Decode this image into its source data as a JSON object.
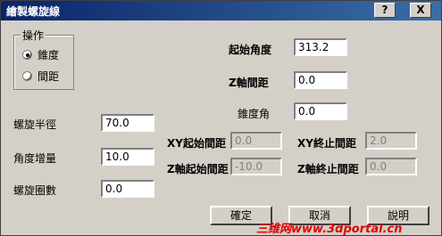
{
  "window": {
    "title": "繪製螺旋線",
    "help": "?",
    "close": "X"
  },
  "mode_group": {
    "label": "操作",
    "options": [
      {
        "label": "錐度",
        "checked": true
      },
      {
        "label": "間距",
        "checked": false
      }
    ]
  },
  "fields": {
    "start_angle": {
      "label": "起始角度",
      "value": "313.2"
    },
    "z_pitch": {
      "label": "Z軸間距",
      "value": "0.0"
    },
    "taper_angle": {
      "label": "錐度角",
      "value": "0.0"
    },
    "radius": {
      "label": "螺旋半徑",
      "value": "70.0"
    },
    "angle_increment": {
      "label": "角度增量",
      "value": "10.0"
    },
    "turns": {
      "label": "螺旋圈數",
      "value": "0.0"
    },
    "xy_start_pitch": {
      "label": "XY起始間距",
      "value": "0.0"
    },
    "xy_end_pitch": {
      "label": "XY終止間距",
      "value": "2.0"
    },
    "z_start_pitch": {
      "label": "Z軸起始間距",
      "value": "-10.0"
    },
    "z_end_pitch": {
      "label": "Z軸終止間距",
      "value": "0.0"
    }
  },
  "buttons": {
    "ok": "確定",
    "cancel": "取消",
    "help": "說明"
  },
  "watermark": "三维网www.3dportal.cn"
}
